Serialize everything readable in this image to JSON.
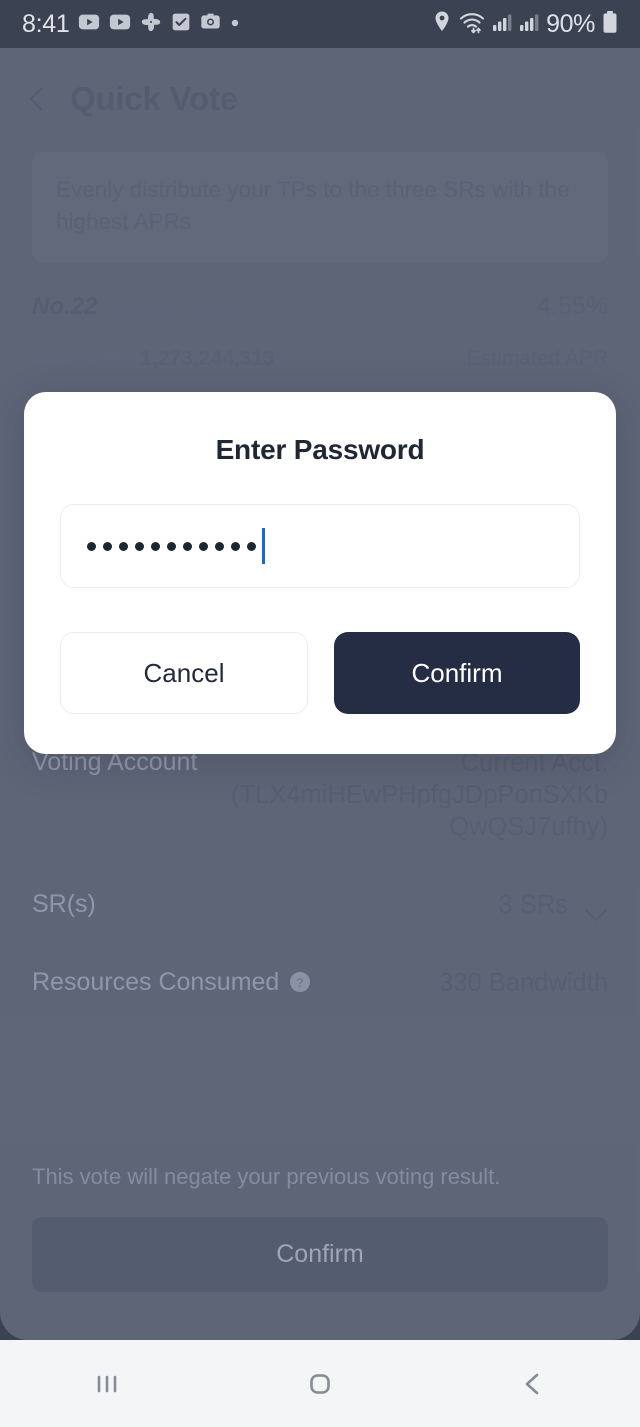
{
  "status_bar": {
    "time": "8:41",
    "battery_percent": "90%",
    "notification_icons": [
      "youtube-icon",
      "youtube-icon",
      "google-photos-icon",
      "tasks-checkbox-icon",
      "camera-icon",
      "more-dot-icon"
    ],
    "system_icons": [
      "location-pin-icon",
      "wifi-icon",
      "signal-bars-icon",
      "signal-bars-icon",
      "battery-icon"
    ]
  },
  "header": {
    "title": "Quick Vote",
    "back_icon": "chevron-left-icon"
  },
  "banner": {
    "text": "Evenly distribute your TPs to the three SRs with the highest APRs"
  },
  "sr_entry": {
    "rank": "No.22",
    "name": "MCDEX001",
    "apr": "4.55%",
    "total_votes_label": "Total votes",
    "total_votes_value": "1,273,244,313",
    "estimated_apr_label": "Estimated APR"
  },
  "details": [
    {
      "label": "Voting Account",
      "value": "Current Acct. (TLX4miHEwPHpfgJDpPonSXKbQwQSJ7ufhy)",
      "help": false,
      "caret": false
    },
    {
      "label": "SR(s)",
      "value": "3 SRs",
      "help": false,
      "caret": true
    },
    {
      "label": "Resources Consumed",
      "value": "330 Bandwidth",
      "help": true,
      "caret": false
    }
  ],
  "bottom": {
    "note": "This vote will negate your previous voting result.",
    "confirm_label": "Confirm"
  },
  "modal": {
    "title": "Enter Password",
    "password_masked_length": 11,
    "password_placeholder": "Enter Password",
    "cancel_label": "Cancel",
    "confirm_label": "Confirm"
  },
  "nav_bar": {
    "recents_icon": "recents-icon",
    "home_icon": "home-icon",
    "back_icon": "back-icon"
  },
  "colors": {
    "app_background": "#3b4252",
    "dim_overlay": "#646b7c",
    "modal_background": "#ffffff",
    "primary_dark": "#242d44",
    "caret_blue": "#1769d8",
    "nav_background": "#f4f5f6"
  }
}
